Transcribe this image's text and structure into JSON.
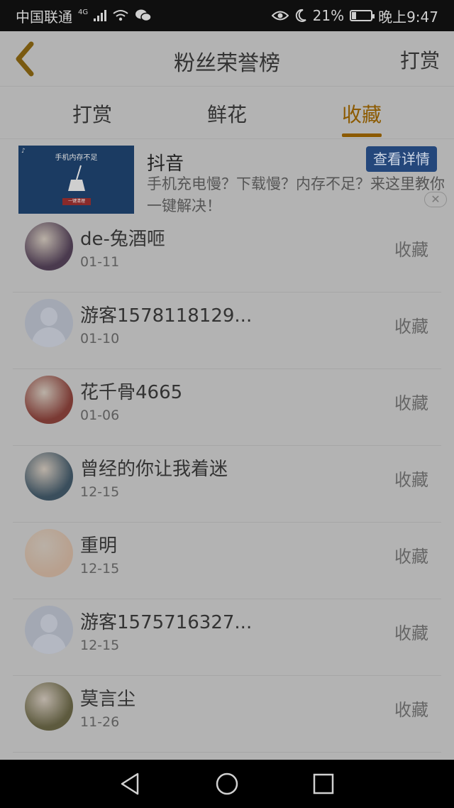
{
  "status_bar": {
    "carrier": "中国联通",
    "network": "4G",
    "battery": "21%",
    "battery_level": 0.21,
    "time": "晚上9:47"
  },
  "header": {
    "title": "粉丝荣誉榜",
    "right_action": "打赏"
  },
  "tabs": [
    {
      "label": "打赏",
      "active": false
    },
    {
      "label": "鲜花",
      "active": false
    },
    {
      "label": "收藏",
      "active": true
    }
  ],
  "ad": {
    "image_title": "手机内存不足",
    "image_button": "一键清理",
    "app_name": "抖音",
    "description": "手机充电慢？下载慢？内存不足？来这里教你一键解决！",
    "button": "查看详情"
  },
  "list": [
    {
      "name": "de-兔酒咂",
      "date": "01-11",
      "action": "收藏",
      "avatar": "photo",
      "avatar_color": "#4a3a4e"
    },
    {
      "name": "游客1578118129...",
      "date": "01-10",
      "action": "收藏",
      "avatar": "default"
    },
    {
      "name": "花千骨4665",
      "date": "01-06",
      "action": "收藏",
      "avatar": "photo",
      "avatar_color": "#7a3a34"
    },
    {
      "name": "曾经的你让我着迷",
      "date": "12-15",
      "action": "收藏",
      "avatar": "photo",
      "avatar_color": "#3a4e5c"
    },
    {
      "name": "重明",
      "date": "12-15",
      "action": "收藏",
      "avatar": "photo",
      "avatar_color": "#b8a08e"
    },
    {
      "name": "游客1575716327...",
      "date": "12-15",
      "action": "收藏",
      "avatar": "default"
    },
    {
      "name": "莫言尘",
      "date": "11-26",
      "action": "收藏",
      "avatar": "photo",
      "avatar_color": "#5d5a3e"
    }
  ],
  "colors": {
    "accent": "#8c5a00",
    "background": "#b3b3b3",
    "ad_button": "#24477b"
  }
}
